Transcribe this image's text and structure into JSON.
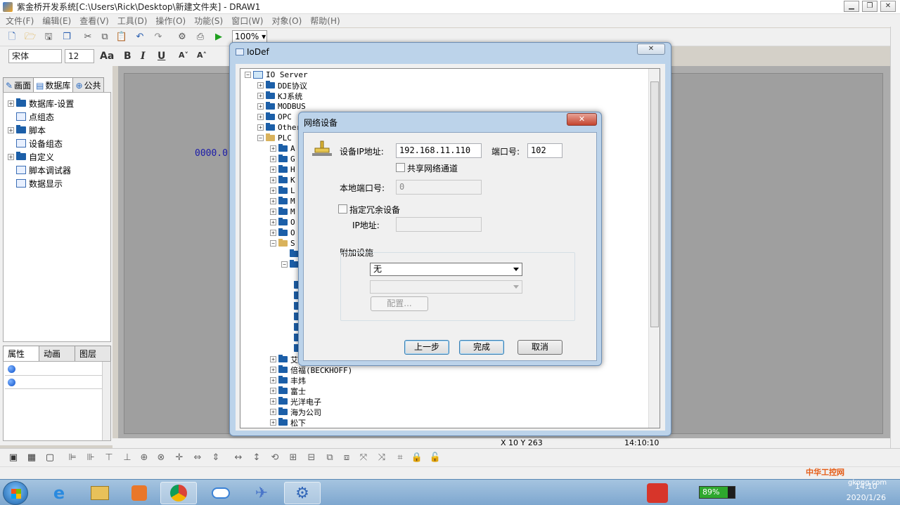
{
  "window": {
    "title": "紫金桥开发系统[C:\\Users\\Rick\\Desktop\\新建文件夹] - DRAW1"
  },
  "menu": [
    "文件(F)",
    "编辑(E)",
    "查看(V)",
    "工具(D)",
    "操作(O)",
    "功能(S)",
    "窗口(W)",
    "对象(O)",
    "帮助(H)"
  ],
  "toolbar": {
    "zoom": "100%",
    "font_name": "宋体",
    "font_size": "12"
  },
  "left_tabs": [
    "画面",
    "数据库",
    "公共"
  ],
  "left_tree": [
    "数据库-设置",
    "点组态",
    "脚本",
    "设备组态",
    "自定义",
    "脚本调试器",
    "数据显示"
  ],
  "prop_tabs": [
    "属性",
    "动画",
    "图层"
  ],
  "canvas": {
    "text": "0000.0"
  },
  "status": {
    "coords": "X 10 Y 263",
    "time": "14:10:10"
  },
  "iodef": {
    "title": "IoDef",
    "tree": [
      "IO Server",
      "DDE协议",
      "KJ系统",
      "MODBUS",
      "OPC",
      "Other",
      "PLC",
      "A",
      "G",
      "H",
      "K",
      "L",
      "M",
      "M",
      "O",
      "O",
      "S",
      "艾",
      "倍福(BECKHOFF)",
      "丰炜",
      "富士",
      "光洋电子",
      "海为公司",
      "松下"
    ]
  },
  "netdlg": {
    "title": "网络设备",
    "ip_label": "设备IP地址:",
    "ip_value": "192.168.11.110",
    "port_label": "端口号:",
    "port_value": "102",
    "share_label": "共享网络通道",
    "local_port_label": "本地端口号:",
    "local_port_value": "0",
    "redundant_label": "指定冗余设备",
    "redundant_ip_label": "IP地址:",
    "addon_label": "附加设施",
    "addon_value": "无",
    "config_button": "配置...",
    "back_button": "上一步",
    "finish_button": "完成",
    "cancel_button": "取消"
  },
  "taskbar": {
    "battery": "89%",
    "time": "14:10",
    "date": "2020/1/26",
    "watermark": "中华工控网",
    "watermark_url": "gkong.com"
  }
}
